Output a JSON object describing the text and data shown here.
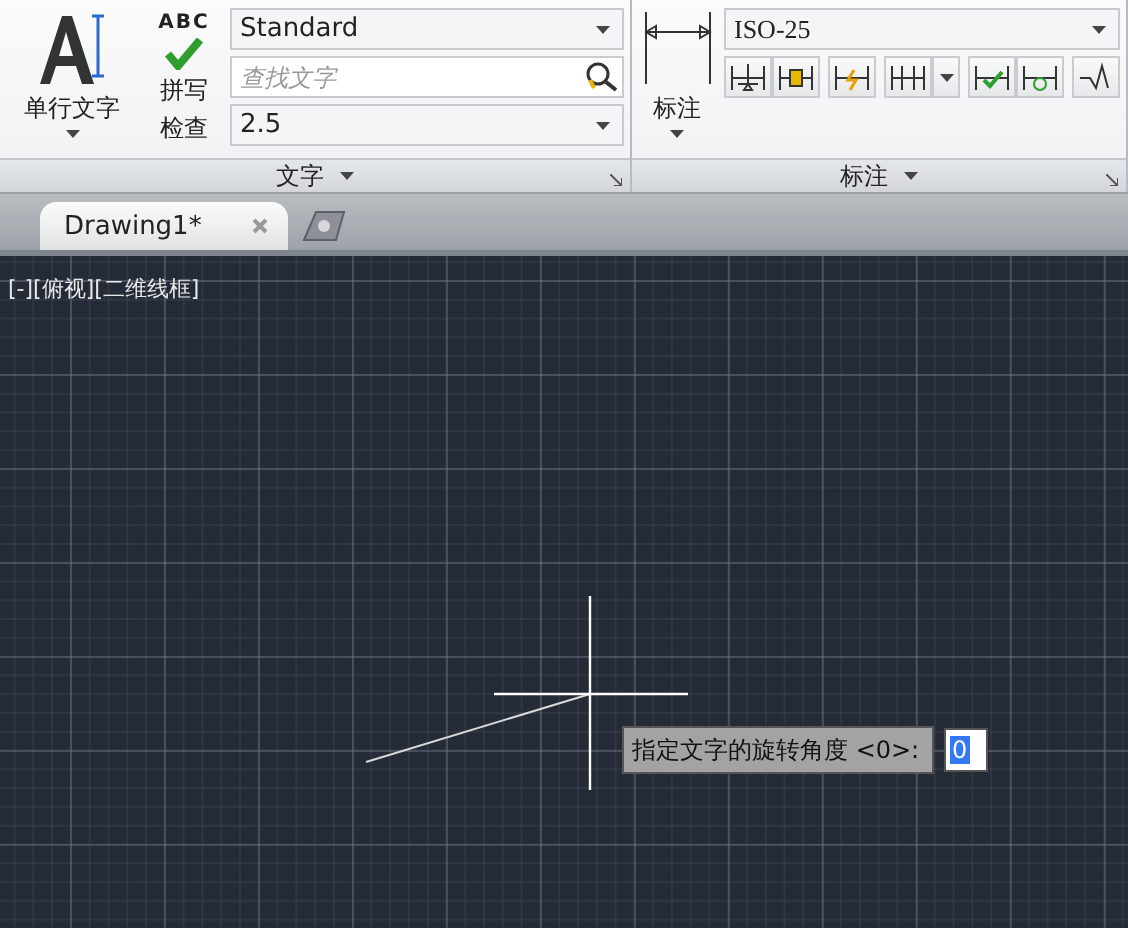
{
  "ribbon": {
    "panels": [
      {
        "kind": "text",
        "title": "文字",
        "large_button": {
          "label": "单行文字"
        },
        "spell_button": {
          "icon_text": "ABC",
          "label_lines": [
            "拼写",
            "检查"
          ]
        },
        "style_dropdown": {
          "value": "Standard"
        },
        "find_field": {
          "placeholder": "查找文字"
        },
        "height_dropdown": {
          "value": "2.5"
        }
      },
      {
        "kind": "dim",
        "title": "标注",
        "large_button": {
          "label": "标注"
        },
        "style_dropdown": {
          "value": "ISO-25"
        }
      }
    ]
  },
  "tabs": [
    {
      "label": "Drawing1*",
      "selected": true
    }
  ],
  "viewport": {
    "label": "[-][俯视][二维线框]"
  },
  "prompt": {
    "text": "指定文字的旋转角度 <0>:",
    "value": "0"
  }
}
